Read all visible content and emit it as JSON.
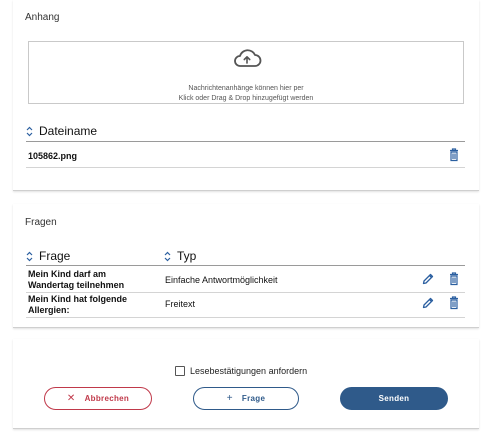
{
  "attachments": {
    "title": "Anhang",
    "dropzone": {
      "icon": "cloud-upload-icon",
      "hint_line1": "Nachrichtenanhänge können hier per",
      "hint_line2": "Klick oder Drag & Drop hinzugefügt werden"
    },
    "table": {
      "header": "Dateiname",
      "rows": [
        {
          "filename": "105862.png"
        }
      ]
    }
  },
  "questions": {
    "title": "Fragen",
    "columns": {
      "question": "Frage",
      "type": "Typ"
    },
    "rows": [
      {
        "question_line1": "Mein Kind darf am",
        "question_line2": "Wandertag teilnehmen",
        "type": "Einfache Antwortmöglichkeit"
      },
      {
        "question_line1": "Mein Kind hat folgende",
        "question_line2": "Allergien:",
        "type": "Freitext"
      }
    ]
  },
  "actions": {
    "read_receipt_label": "Lesebestätigungen anfordern",
    "read_receipt_checked": false,
    "cancel_label": "Abbrechen",
    "add_question_label": "Frage",
    "send_label": "Senden"
  },
  "colors": {
    "primary": "#2f5a8a",
    "danger": "#c0394a",
    "icon_blue": "#2b5fa0"
  }
}
